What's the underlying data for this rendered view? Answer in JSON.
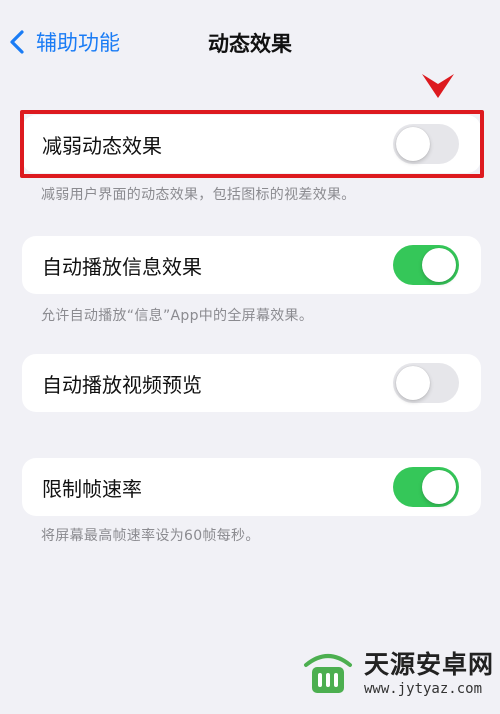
{
  "nav": {
    "back_label": "辅助功能",
    "title": "动态效果"
  },
  "settings": [
    {
      "label": "减弱动态效果",
      "on": false,
      "footnote": "减弱用户界面的动态效果，包括图标的视差效果。"
    },
    {
      "label": "自动播放信息效果",
      "on": true,
      "footnote": "允许自动播放“信息”App中的全屏幕效果。"
    },
    {
      "label": "自动播放视频预览",
      "on": false,
      "footnote": ""
    },
    {
      "label": "限制帧速率",
      "on": true,
      "footnote": "将屏幕最高帧速率设为60帧每秒。"
    }
  ],
  "watermark": {
    "name": "天源安卓网",
    "url": "www.jytyaz.com"
  },
  "colors": {
    "accent": "#1a7cf5",
    "toggle_on": "#35c759",
    "toggle_off": "#e6e6ea",
    "annotation": "#dd1a1f",
    "background": "#f1f1f6"
  }
}
